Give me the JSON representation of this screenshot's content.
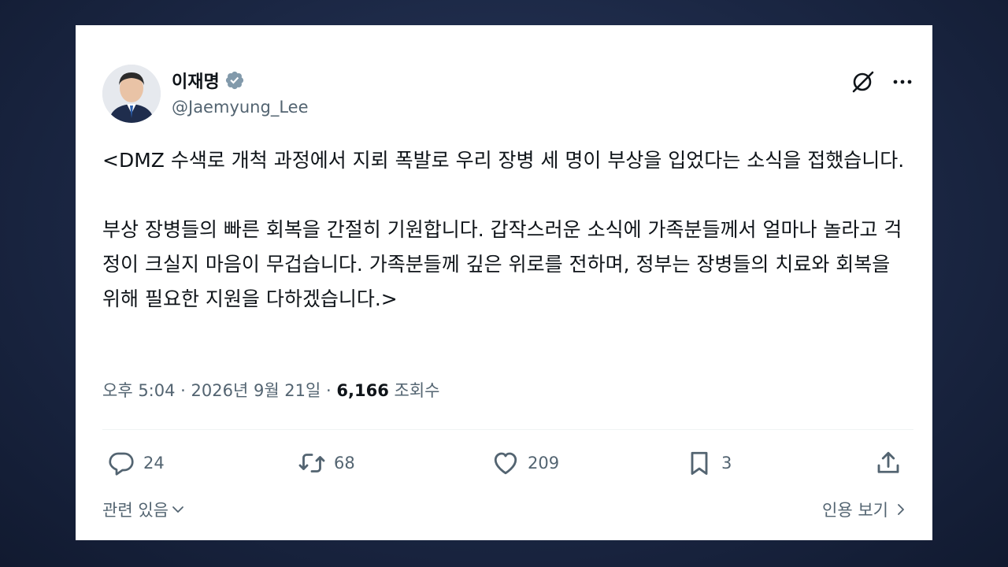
{
  "tweet": {
    "author": {
      "display_name": "이재명",
      "handle": "@Jaemyung_Lee",
      "verified_icon": "verified-badge-icon"
    },
    "text": {
      "paragraph1": "<DMZ 수색로 개척 과정에서 지뢰 폭발로 우리 장병 세 명이 부상을 입었다는 소식을 접했습니다.",
      "paragraph2": "부상 장병들의 빠른 회복을 간절히 기원합니다. 갑작스러운 소식에 가족분들께서 얼마나 놀라고 걱정이 크실지 마음이 무겁습니다. 가족분들께 깊은 위로를 전하며, 정부는 장병들의 치료와 회복을 위해 필요한 지원을 다하겠습니다.>"
    },
    "meta": {
      "time": "오후 5:04",
      "separator": " · ",
      "date": "2026년 9월 21일",
      "views_count": "6,166",
      "views_label": "조회수"
    },
    "actions": {
      "replies": "24",
      "reposts": "68",
      "likes": "209",
      "bookmarks": "3"
    },
    "footer": {
      "related_label": "관련 있음",
      "quotes_label": "인용 보기"
    }
  },
  "colors": {
    "text_primary": "#0f1419",
    "text_secondary": "#536471",
    "verified_badge": "#829aab",
    "background": "#1b2744"
  }
}
